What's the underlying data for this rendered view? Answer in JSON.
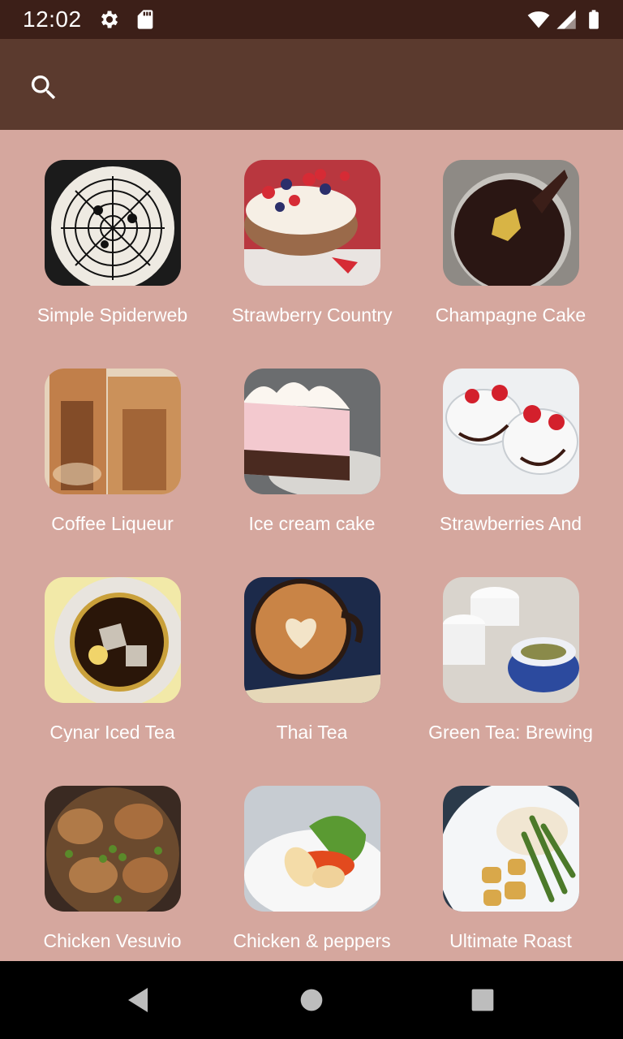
{
  "status_bar": {
    "time": "12:02",
    "icons": [
      "gear-icon",
      "sd-card-icon",
      "wifi-icon",
      "cell-signal-icon",
      "battery-icon"
    ]
  },
  "app_bar": {
    "search_icon": "search-icon"
  },
  "colors": {
    "status_bar": "#3c1f18",
    "app_bar": "#5b3a2e",
    "background": "#d5a79e",
    "label_text": "#ffffff",
    "nav_bar": "#000000"
  },
  "recipes": [
    {
      "name": "Simple Spiderweb"
    },
    {
      "name": "Strawberry Country"
    },
    {
      "name": "Champagne Cake"
    },
    {
      "name": "Coffee Liqueur"
    },
    {
      "name": "Ice cream cake"
    },
    {
      "name": "Strawberries And"
    },
    {
      "name": "Cynar Iced Tea"
    },
    {
      "name": "Thai Tea"
    },
    {
      "name": "Green Tea: Brewing"
    },
    {
      "name": "Chicken Vesuvio"
    },
    {
      "name": "Chicken & peppers"
    },
    {
      "name": "Ultimate Roast"
    }
  ],
  "nav_bar": {
    "buttons": [
      "back-icon",
      "home-icon",
      "recents-icon"
    ]
  }
}
